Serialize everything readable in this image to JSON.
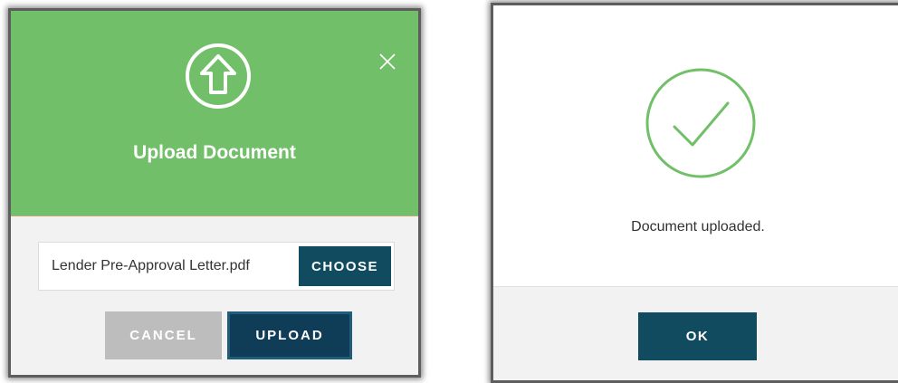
{
  "upload_dialog": {
    "title": "Upload Document",
    "header_icon": "upload-arrow-icon",
    "close_icon": "close-icon",
    "file_name": "Lender Pre-Approval Letter.pdf",
    "choose_label": "CHOOSE",
    "cancel_label": "CANCEL",
    "upload_label": "UPLOAD",
    "colors": {
      "header": "#72bf69",
      "primary_button": "#114b5f",
      "cancel_button": "#bdbdbd",
      "body": "#f2f2f2"
    }
  },
  "success_dialog": {
    "icon": "check-circle-icon",
    "message": "Document uploaded.",
    "ok_label": "OK",
    "colors": {
      "check": "#72bf69",
      "primary_button": "#114b5f",
      "footer": "#f2f2f2"
    }
  }
}
